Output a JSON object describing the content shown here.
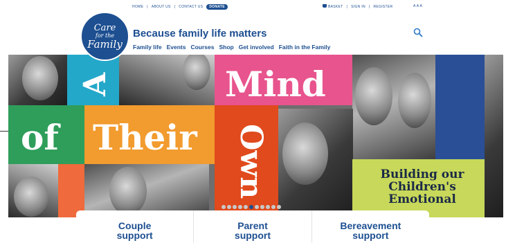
{
  "topbar": {
    "links": [
      "HOME",
      "ABOUT US",
      "CONTACT US"
    ],
    "donate": "DONATE",
    "basket": "BASKET",
    "sign_in": "SIGN IN",
    "register": "REGISTER",
    "text_size": "A A A"
  },
  "header": {
    "logo": {
      "line1": "Care",
      "line2": "for the",
      "line3": "Family"
    },
    "tagline": "Because family life matters",
    "nav": [
      "Family life",
      "Events",
      "Courses",
      "Shop",
      "Get involved",
      "Faith in the Family"
    ],
    "search_icon": "search-icon"
  },
  "hero": {
    "words": {
      "a": "A",
      "mind": "Mind",
      "of": "of",
      "their": "Their",
      "own": "Own"
    },
    "card_text": "Building our Children's Emotional",
    "slide_count": 11,
    "active_slide": 5,
    "colors": {
      "teal": "#24a8c9",
      "pink": "#e8548d",
      "orange": "#f29b2e",
      "green": "#2e9e5a",
      "red": "#e04a1c",
      "lime": "#c7d85a",
      "navy": "#2a4f96"
    }
  },
  "cards": [
    {
      "label_1": "Couple",
      "label_2": "support"
    },
    {
      "label_1": "Parent",
      "label_2": "support"
    },
    {
      "label_1": "Bereavement",
      "label_2": "support"
    }
  ]
}
